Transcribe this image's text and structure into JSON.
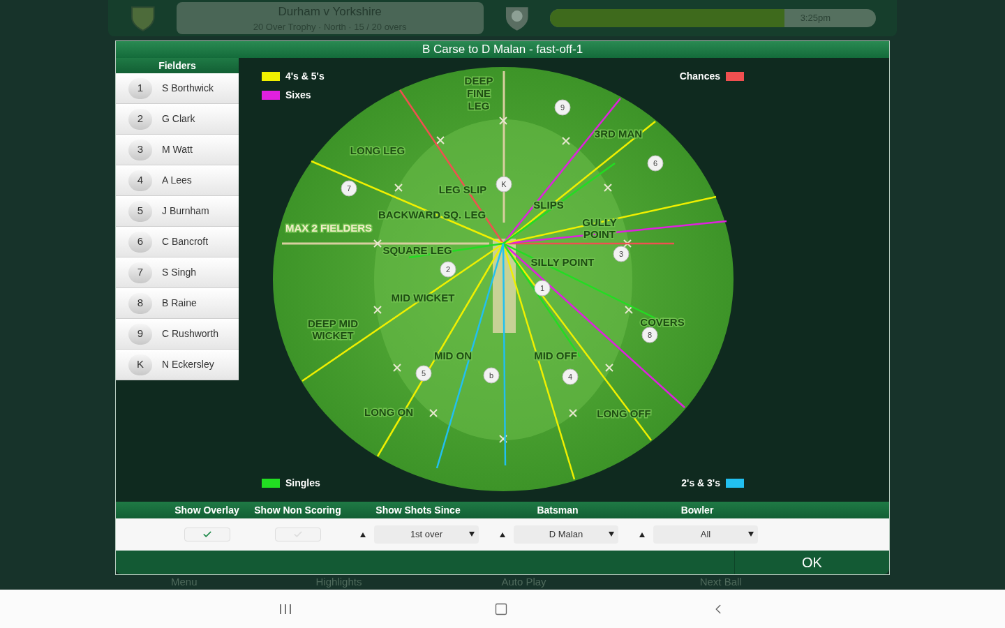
{
  "header": {
    "match": "Durham v Yorkshire",
    "competition": "20 Over Trophy · North · 15 / 20 overs",
    "clock": "3:25pm",
    "level": 0.72
  },
  "dialog": {
    "title": "B Carse to D Malan - fast-off-1"
  },
  "fielders": {
    "title": "Fielders",
    "items": [
      {
        "number": "1",
        "name": "S Borthwick"
      },
      {
        "number": "2",
        "name": "G Clark"
      },
      {
        "number": "3",
        "name": "M Watt"
      },
      {
        "number": "4",
        "name": "A Lees"
      },
      {
        "number": "5",
        "name": "J Burnham"
      },
      {
        "number": "6",
        "name": "C Bancroft"
      },
      {
        "number": "7",
        "name": "S Singh"
      },
      {
        "number": "8",
        "name": "B Raine"
      },
      {
        "number": "9",
        "name": "C Rushworth"
      },
      {
        "number": "K",
        "name": "N Eckersley"
      }
    ]
  },
  "legend": [
    {
      "label": "4's & 5's",
      "color": "#f0f000"
    },
    {
      "label": "Chances",
      "color": "#f05050"
    },
    {
      "label": "Sixes",
      "color": "#e020e0"
    },
    {
      "label": "Singles",
      "color": "#22dd22"
    },
    {
      "label": "2's & 3's",
      "color": "#22c0f0"
    }
  ],
  "field": {
    "zone_labels": [
      {
        "kind": "zone",
        "lines": [
          "DEEP",
          "FINE",
          "LEG"
        ]
      },
      {
        "kind": "zone",
        "lines": [
          "LONG LEG"
        ]
      },
      {
        "kind": "zone",
        "lines": [
          "3RD MAN"
        ]
      },
      {
        "kind": "zone",
        "lines": [
          "LEG SLIP"
        ]
      },
      {
        "kind": "zone",
        "lines": [
          "SLIPS"
        ]
      },
      {
        "kind": "zone",
        "lines": [
          "BACKWARD SQ. LEG"
        ]
      },
      {
        "kind": "zone",
        "lines": [
          "GULLY",
          "POINT"
        ]
      },
      {
        "kind": "note",
        "lines": [
          "MAX 2 FIELDERS"
        ]
      },
      {
        "kind": "zone",
        "lines": [
          "SQUARE LEG"
        ]
      },
      {
        "kind": "zone",
        "lines": [
          "SILLY POINT"
        ]
      },
      {
        "kind": "zone",
        "lines": [
          "MID WICKET"
        ]
      },
      {
        "kind": "zone",
        "lines": [
          "DEEP MID",
          "WICKET"
        ]
      },
      {
        "kind": "zone",
        "lines": [
          "COVERS"
        ]
      },
      {
        "kind": "zone",
        "lines": [
          "MID ON"
        ]
      },
      {
        "kind": "zone",
        "lines": [
          "MID OFF"
        ]
      },
      {
        "kind": "zone",
        "lines": [
          "LONG ON"
        ]
      },
      {
        "kind": "zone",
        "lines": [
          "LONG OFF"
        ]
      }
    ],
    "markers": [
      "9",
      "6",
      "7",
      "K",
      "3",
      "2",
      "1",
      "8",
      "5",
      "b",
      "4"
    ]
  },
  "controls": [
    {
      "kind": "checkbox",
      "label": "Show Overlay",
      "checked": true
    },
    {
      "kind": "checkbox",
      "label": "Show Non Scoring",
      "checked": false
    },
    {
      "kind": "dropdown",
      "label": "Show Shots Since",
      "value": "1st over"
    },
    {
      "kind": "dropdown",
      "label": "Batsman",
      "value": "D Malan"
    },
    {
      "kind": "dropdown",
      "label": "Bowler",
      "value": "All"
    }
  ],
  "ok_button": "OK",
  "bottom_nav": [
    "Menu",
    "Highlights",
    "Auto Play",
    "Next Ball"
  ]
}
